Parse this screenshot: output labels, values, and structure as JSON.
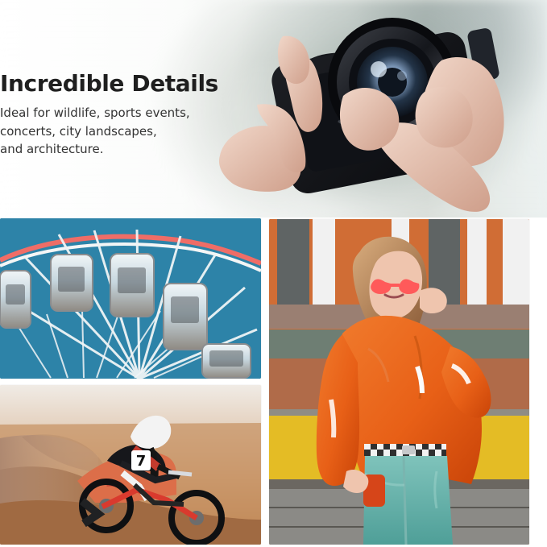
{
  "hero": {
    "title": "Incredible Details",
    "description_lines": [
      "Ideal for wildlife, sports events,",
      "concerts, city landscapes,",
      "and architecture."
    ]
  },
  "colors": {
    "text_primary": "#1f1f1f",
    "text_secondary": "#333333",
    "sky_blue": "#2f86ab",
    "jacket_orange": "#e85f17",
    "wall_yellow": "#e4bc25",
    "dirt_brown": "#b87c4c"
  },
  "icons": {
    "hero_visual": "camera-phone-icon",
    "ferris_visual": "ferris-wheel-icon",
    "moto_visual": "motorbike-icon",
    "fashion_visual": "fashion-person-icon"
  },
  "scenes": {
    "ferris_number": "",
    "moto_number": "7"
  }
}
